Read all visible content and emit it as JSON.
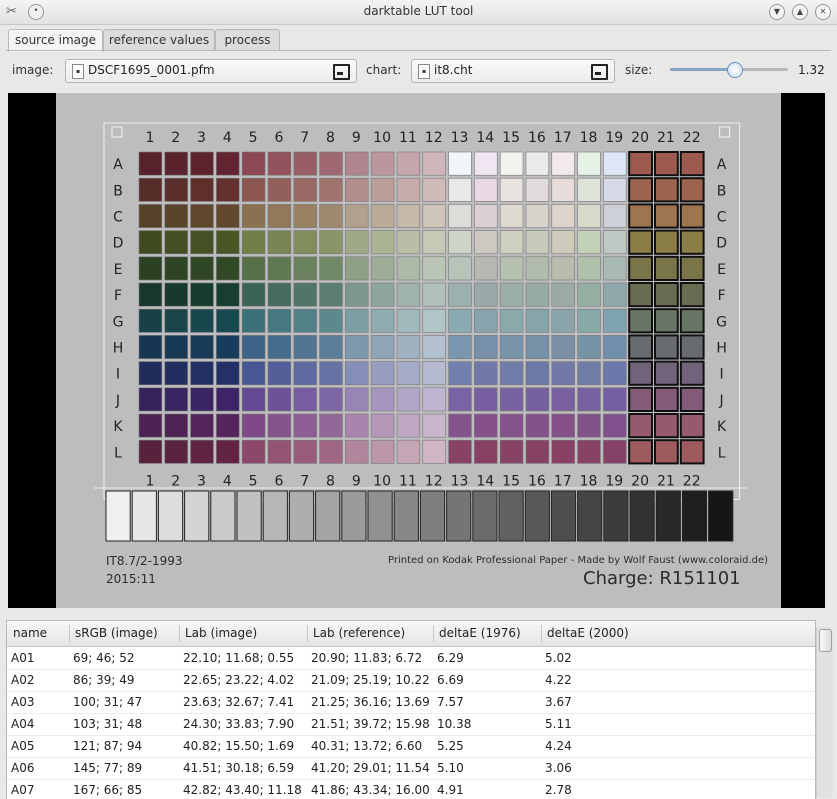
{
  "window": {
    "title": "darktable LUT tool"
  },
  "tabs": [
    {
      "label": "source image",
      "active": true
    },
    {
      "label": "reference values",
      "active": false
    },
    {
      "label": "process",
      "active": false
    }
  ],
  "toolbar": {
    "image_label": "image:",
    "image_file": "DSCF1695_0001.pfm",
    "chart_label": "chart:",
    "chart_file": "it8.cht",
    "size_label": "size:",
    "size_value": "1.32",
    "size_fraction": 0.54
  },
  "chart": {
    "columns": [
      "1",
      "2",
      "3",
      "4",
      "5",
      "6",
      "7",
      "8",
      "9",
      "10",
      "11",
      "12",
      "13",
      "14",
      "15",
      "16",
      "17",
      "18",
      "19",
      "20",
      "21",
      "22"
    ],
    "rows": [
      "A",
      "B",
      "C",
      "D",
      "E",
      "F",
      "G",
      "H",
      "I",
      "J",
      "K",
      "L"
    ],
    "footer_left": "IT8.7/2-1993",
    "footer_date": "2015:11",
    "footer_right": "Printed on Kodak Professional Paper  -  Made by Wolf Faust (www.coloraid.de)",
    "charge": "Charge: R151101",
    "gray_steps": 24,
    "hue_colors": [
      "#7a2a38",
      "#7a3a34",
      "#7a5a34",
      "#5a6a2a",
      "#3a5a2a",
      "#1a4a3a",
      "#1a5a62",
      "#1a4a72",
      "#2a3a82",
      "#4a2a82",
      "#6a2a72",
      "#7a2a52"
    ],
    "bright_colors": [
      "#f2f6fa",
      "#f0e6f2",
      "#f2f2ee",
      "#eaeaea",
      "#f2eaea",
      "#e6f2e6",
      "#dde6f6"
    ]
  },
  "table": {
    "columns": [
      "name",
      "sRGB (image)",
      "Lab (image)",
      "Lab (reference)",
      "deltaE (1976)",
      "deltaE (2000)"
    ],
    "rows": [
      [
        "A01",
        "69; 46; 52",
        "22.10; 11.68; 0.55",
        "20.90; 11.83; 6.72",
        "6.29",
        "5.02"
      ],
      [
        "A02",
        "86; 39; 49",
        "22.65; 23.22; 4.02",
        "21.09; 25.19; 10.22",
        "6.69",
        "4.22"
      ],
      [
        "A03",
        "100; 31; 47",
        "23.63; 32.67; 7.41",
        "21.25; 36.16; 13.69",
        "7.57",
        "3.67"
      ],
      [
        "A04",
        "103; 31; 48",
        "24.30; 33.83; 7.90",
        "21.51; 39.72; 15.98",
        "10.38",
        "5.11"
      ],
      [
        "A05",
        "121; 87; 94",
        "40.82; 15.50; 1.69",
        "40.31; 13.72; 6.60",
        "5.25",
        "4.24"
      ],
      [
        "A06",
        "145; 77; 89",
        "41.51; 30.18; 6.59",
        "41.20; 29.01; 11.54",
        "5.10",
        "3.06"
      ],
      [
        "A07",
        "167; 66; 85",
        "42.82; 43.40; 11.18",
        "41.86; 43.34; 16.00",
        "4.91",
        "2.78"
      ]
    ]
  }
}
